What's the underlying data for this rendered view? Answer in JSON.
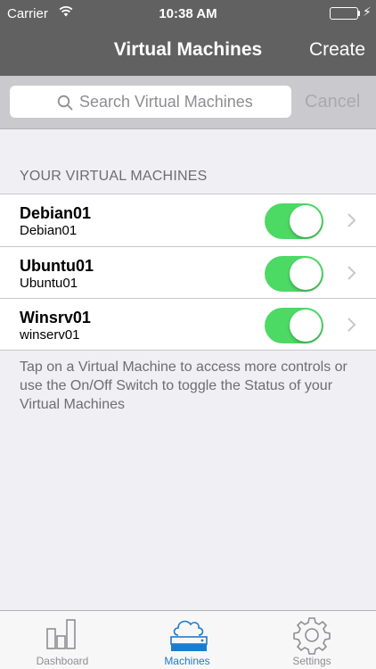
{
  "status_bar": {
    "carrier": "Carrier",
    "time": "10:38 AM",
    "battery_level": 1.0
  },
  "nav": {
    "title": "Virtual Machines",
    "create_label": "Create"
  },
  "search": {
    "placeholder": "Search Virtual Machines",
    "value": "",
    "cancel_label": "Cancel"
  },
  "section": {
    "header": "YOUR VIRTUAL MACHINES"
  },
  "vms": [
    {
      "name": "Debian01",
      "hostname": "Debian01",
      "on": true
    },
    {
      "name": "Ubuntu01",
      "hostname": "Ubuntu01",
      "on": true
    },
    {
      "name": "Winsrv01",
      "hostname": "winserv01",
      "on": true
    }
  ],
  "footer_note": "Tap on a Virtual Machine to access more controls or use the On/Off Switch to toggle the Status of your Virtual Machines",
  "tabs": [
    {
      "label": "Dashboard",
      "icon": "bar-chart-icon",
      "active": false
    },
    {
      "label": "Machines",
      "icon": "cloud-server-icon",
      "active": true
    },
    {
      "label": "Settings",
      "icon": "gear-icon",
      "active": false
    }
  ],
  "colors": {
    "header_bg": "#616161",
    "toggle_on": "#4cd964",
    "tab_active": "#1b7ccc",
    "battery": "#4cd964"
  }
}
